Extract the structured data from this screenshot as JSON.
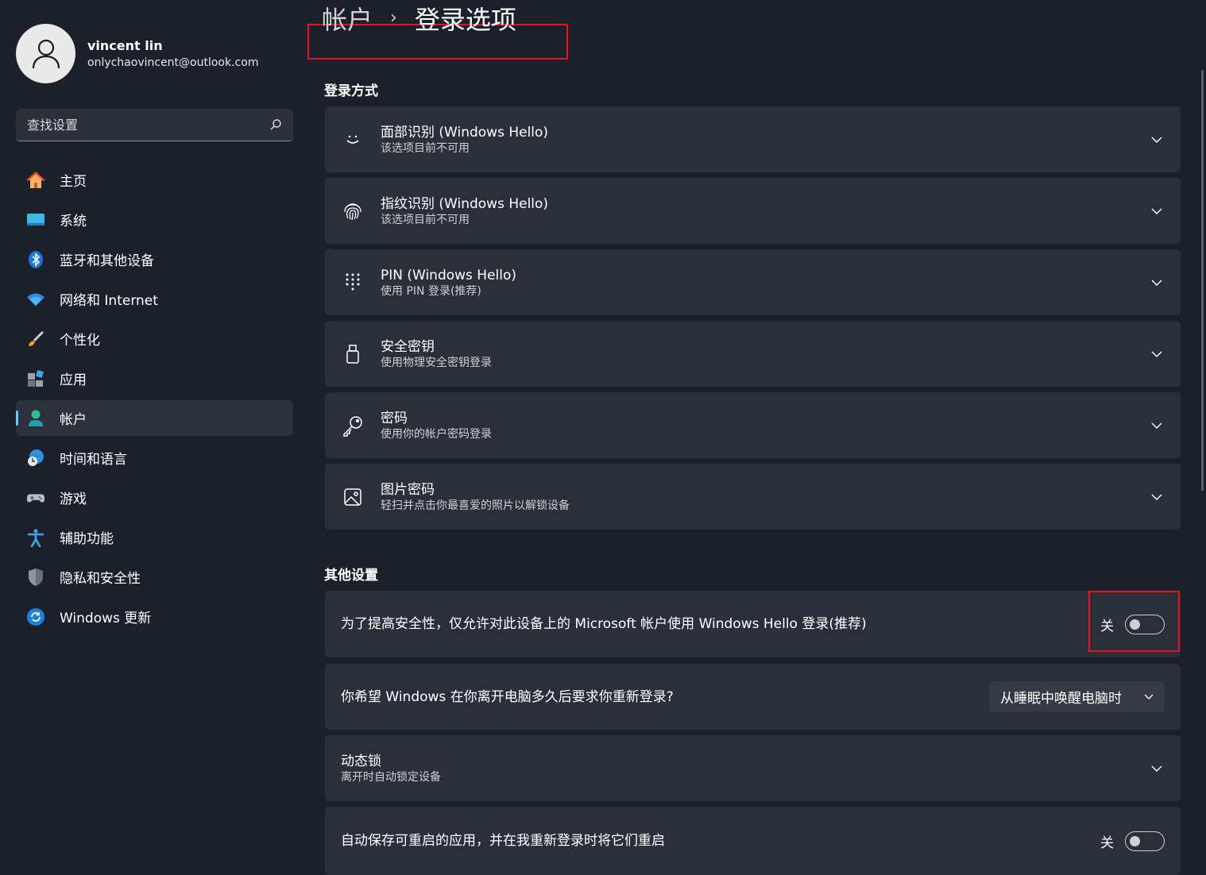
{
  "profile": {
    "name": "vincent lin",
    "email": "onlychaovincent@outlook.com"
  },
  "search": {
    "placeholder": "查找设置"
  },
  "nav": {
    "items": [
      {
        "label": "主页",
        "icon": "home-icon"
      },
      {
        "label": "系统",
        "icon": "system-icon"
      },
      {
        "label": "蓝牙和其他设备",
        "icon": "bluetooth-icon"
      },
      {
        "label": "网络和 Internet",
        "icon": "wifi-icon"
      },
      {
        "label": "个性化",
        "icon": "brush-icon"
      },
      {
        "label": "应用",
        "icon": "apps-icon"
      },
      {
        "label": "帐户",
        "icon": "account-icon",
        "active": true
      },
      {
        "label": "时间和语言",
        "icon": "globe-clock-icon"
      },
      {
        "label": "游戏",
        "icon": "gamepad-icon"
      },
      {
        "label": "辅助功能",
        "icon": "accessibility-icon"
      },
      {
        "label": "隐私和安全性",
        "icon": "shield-icon"
      },
      {
        "label": "Windows 更新",
        "icon": "update-icon"
      }
    ]
  },
  "breadcrumb": {
    "parent": "帐户",
    "separator": "›",
    "current": "登录选项"
  },
  "signin": {
    "title": "登录方式",
    "items": [
      {
        "title": "面部识别 (Windows Hello)",
        "subtitle": "该选项目前不可用",
        "icon": "face-icon"
      },
      {
        "title": "指纹识别 (Windows Hello)",
        "subtitle": "该选项目前不可用",
        "icon": "fingerprint-icon"
      },
      {
        "title": "PIN (Windows Hello)",
        "subtitle": "使用 PIN 登录(推荐)",
        "icon": "pin-keypad-icon"
      },
      {
        "title": "安全密钥",
        "subtitle": "使用物理安全密钥登录",
        "icon": "usb-key-icon"
      },
      {
        "title": "密码",
        "subtitle": "使用你的帐户密码登录",
        "icon": "key-icon"
      },
      {
        "title": "图片密码",
        "subtitle": "轻扫并点击你最喜爱的照片以解锁设备",
        "icon": "picture-icon"
      }
    ]
  },
  "other": {
    "title": "其他设置",
    "hello_only": {
      "label": "为了提高安全性，仅允许对此设备上的 Microsoft 帐户使用 Windows Hello 登录(推荐)",
      "state": "关"
    },
    "relogin": {
      "label": "你希望 Windows 在你离开电脑多久后要求你重新登录?",
      "value": "从睡眠中唤醒电脑时"
    },
    "dynamic_lock": {
      "title": "动态锁",
      "subtitle": "离开时自动锁定设备"
    },
    "restart_apps": {
      "label": "自动保存可重启的应用，并在我重新登录时将它们重启",
      "state": "关"
    }
  },
  "colors": {
    "accent": "#60cdff",
    "highlight_box": "#e8141b",
    "card": "#2b2f3a",
    "background": "#1c202b"
  }
}
